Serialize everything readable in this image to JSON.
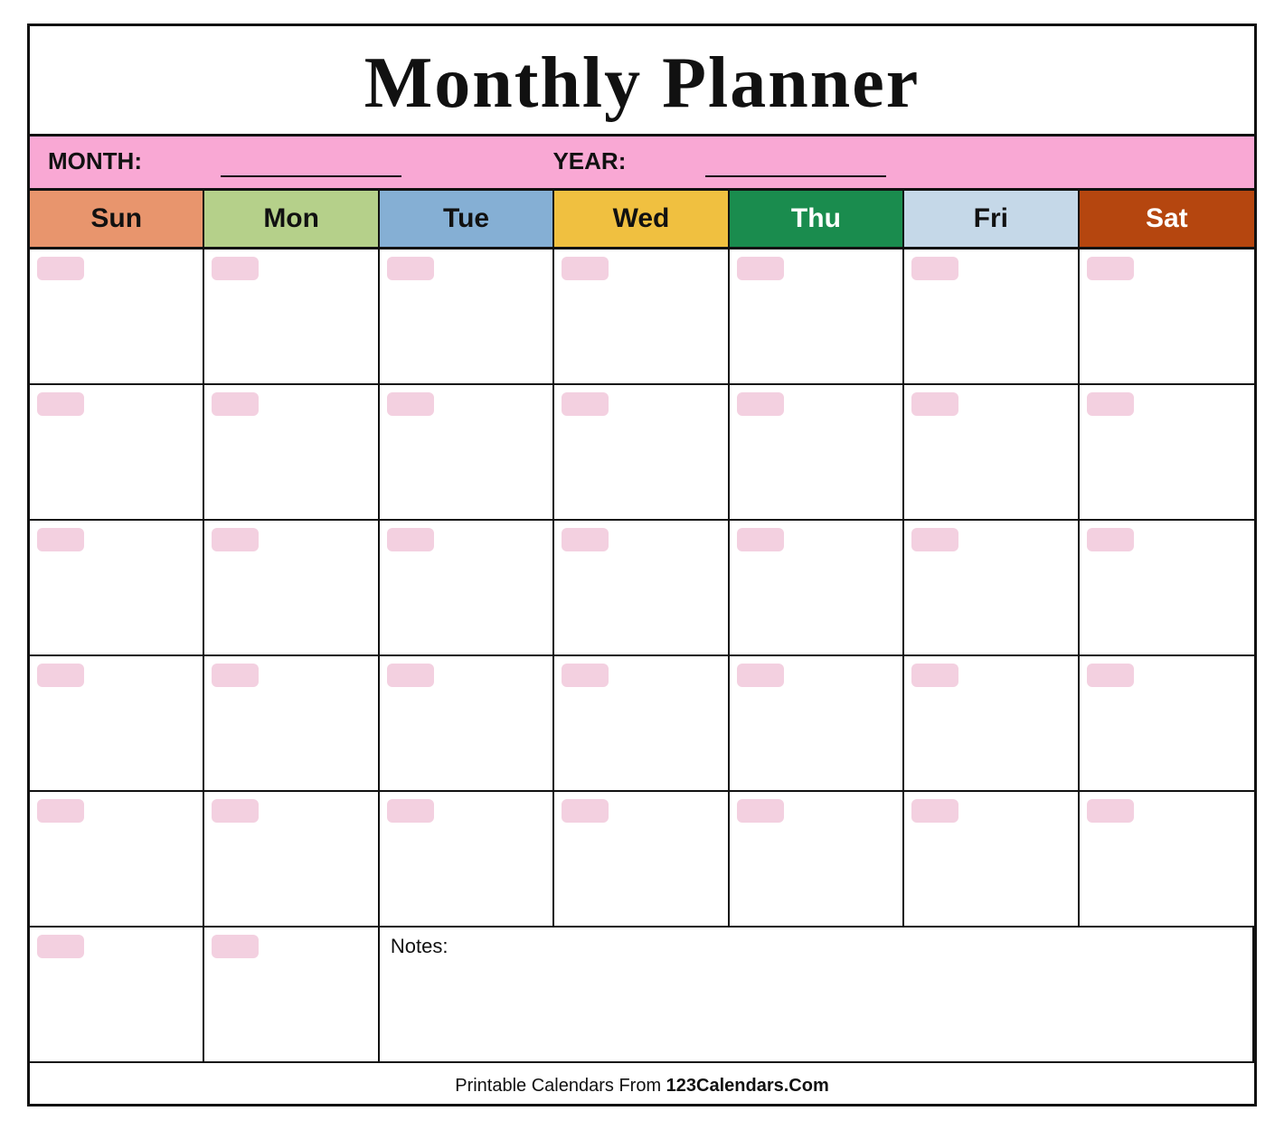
{
  "title": "Monthly Planner",
  "month_label": "MONTH:",
  "year_label": "YEAR:",
  "days": [
    "Sun",
    "Mon",
    "Tue",
    "Wed",
    "Thu",
    "Fri",
    "Sat"
  ],
  "day_colors": [
    "#e8956d",
    "#b5d08a",
    "#85afd4",
    "#f0c040",
    "#1a8c4e",
    "#c5d8e8",
    "#b5460f"
  ],
  "day_text_colors": [
    "#111",
    "#111",
    "#111",
    "#111",
    "#fff",
    "#111",
    "#fff"
  ],
  "num_rows": 6,
  "notes_label": "Notes:",
  "footer_text": "Printable Calendars From ",
  "footer_brand": "123Calendars.Com",
  "badge_color": "#f3d0e0"
}
